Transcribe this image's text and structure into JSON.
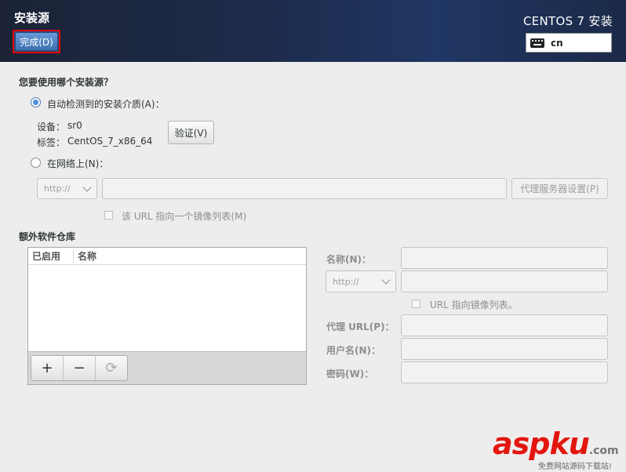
{
  "header": {
    "title": "安装源",
    "done_label": "完成(D)",
    "product": "CENTOS 7 安装",
    "keyboard_layout": "cn"
  },
  "source": {
    "question": "您要使用哪个安装源？",
    "auto_detect_label": "自动检测到的安装介质(A)：",
    "auto_detect_selected": true,
    "device_label": "设备：",
    "device_value": "sr0",
    "tag_label": "标签：",
    "tag_value": "CentOS_7_x86_64",
    "verify_label": "验证(V)",
    "network_label": "在网络上(N)：",
    "network_selected": false,
    "protocol": "http://",
    "url_value": "",
    "proxy_button": "代理服务器设置(P)",
    "mirror_list_label": "该 URL 指向一个镜像列表(M)"
  },
  "repos": {
    "heading": "额外软件仓库",
    "columns": [
      "已启用",
      "名称"
    ],
    "rows": [],
    "add_label": "+",
    "remove_label": "−",
    "refresh_label": "⟳"
  },
  "repo_form": {
    "name_label": "名称(N)：",
    "protocol": "http://",
    "mirror_label": "URL 指向镜像列表。",
    "proxy_url_label": "代理 URL(P)：",
    "username_label": "用户名(N)：",
    "password_label": "密码(W)："
  },
  "watermark": {
    "brand": "aspku",
    "tld": ".com",
    "tagline": "免费网站源码下载站!"
  },
  "colors": {
    "header_start": "#1b2335",
    "header_end": "#203663",
    "accent": "#4a90d9",
    "highlight_border": "#e00000",
    "watermark": "#e3160f"
  }
}
